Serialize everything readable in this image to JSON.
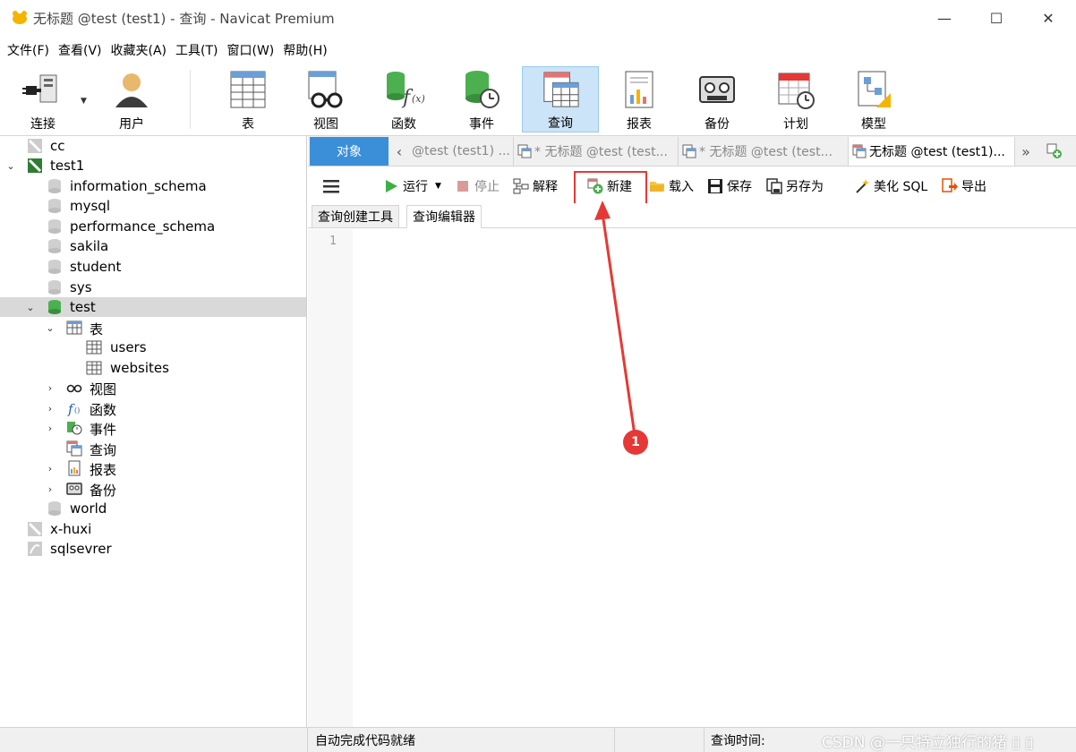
{
  "window": {
    "title": "无标题 @test (test1) - 查询 - Navicat Premium",
    "minimize_glyph": "—",
    "maximize_glyph": "☐",
    "close_glyph": "✕"
  },
  "menu": [
    "文件(F)",
    "查看(V)",
    "收藏夹(A)",
    "工具(T)",
    "窗口(W)",
    "帮助(H)"
  ],
  "toolbar": {
    "connect": "连接",
    "user": "用户",
    "table": "表",
    "view": "视图",
    "function": "函数",
    "event": "事件",
    "query": "查询",
    "report": "报表",
    "backup": "备份",
    "schedule": "计划",
    "model": "模型"
  },
  "tree": {
    "cc": "cc",
    "test1": "test1",
    "information_schema": "information_schema",
    "mysql": "mysql",
    "performance_schema": "performance_schema",
    "sakila": "sakila",
    "student": "student",
    "sys": "sys",
    "test": "test",
    "tables": "表",
    "users": "users",
    "websites": "websites",
    "views": "视图",
    "functions": "函数",
    "events": "事件",
    "queries": "查询",
    "reports": "报表",
    "backups": "备份",
    "world": "world",
    "x_huxi": "x-huxi",
    "sqlsevrer": "sqlsevrer"
  },
  "tabs": {
    "objects": "对象",
    "tab1": "@test (test1) ...",
    "tab2": "* 无标题 @test (test...",
    "tab3": "* 无标题 @test (test...",
    "tab4": "无标题 @test (test1)..."
  },
  "query_toolbar": {
    "run": "运行",
    "stop": "停止",
    "explain": "解释",
    "new": "新建",
    "load": "载入",
    "save": "保存",
    "save_as": "另存为",
    "beautify": "美化 SQL",
    "export": "导出"
  },
  "subtabs": {
    "builder": "查询创建工具",
    "editor": "查询编辑器"
  },
  "editor": {
    "line1": "1"
  },
  "annotation": {
    "badge": "1",
    "color": "#e53935"
  },
  "status": {
    "autocomplete": "自动完成代码就绪",
    "query_time": "查询时间:",
    "watermark": "CSDN @一只特立独行的猪 ▯ ▯"
  },
  "colors": {
    "accent": "#3b8fd8",
    "selected_toolbar": "#cce4f7",
    "highlight": "#e53935"
  }
}
